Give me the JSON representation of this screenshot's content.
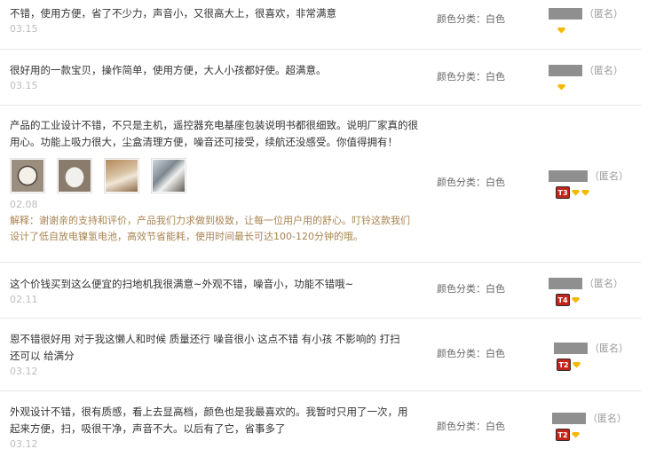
{
  "reviews": [
    {
      "comment": "不错，使用方便，省了不少力，声音小，又很高大上，很喜欢，非常满意",
      "date": "03.15",
      "attr": "颜色分类：白色",
      "anon": "（匿名）",
      "level": "",
      "gems": 1
    },
    {
      "comment": "很好用的一款宝贝，操作简单，使用方便，大人小孩都好使。超满意。",
      "date": "03.15",
      "attr": "颜色分类：白色",
      "anon": "（匿名）",
      "level": "",
      "gems": 1
    },
    {
      "comment": "产品的工业设计不错，不只是主机，遥控器充电基座包装说明书都很细致。说明厂家真的很用心。功能上吸力很大，尘盒清理方便，噪音还可接受，续航还没感受。你值得拥有！",
      "date": "02.08",
      "reply": "解释：谢谢亲的支持和评价，产品我们力求做到极致，让每一位用户用的舒心。叮铃这款我们设计了低自放电镍氢电池，高效节省能耗，使用时间最长可达100-120分钟的哦。",
      "attr": "颜色分类：白色",
      "anon": "（匿名）",
      "level": "T3",
      "gems": 2,
      "photos": [
        "photo-1",
        "photo-2",
        "photo-3",
        "photo-4"
      ]
    },
    {
      "comment": "这个价钱买到这么便宜的扫地机我很满意~外观不错，噪音小，功能不错哦~",
      "date": "02.11",
      "attr": "颜色分类：白色",
      "anon": "（匿名）",
      "level": "T4",
      "gems": 1
    },
    {
      "comment": "恩不错很好用 对于我这懒人和时候 质量还行 噪音很小 这点不错 有小孩 不影响的 打扫还可以 给满分",
      "date": "03.12",
      "attr": "颜色分类：白色",
      "anon": "（匿名）",
      "level": "T2",
      "gems": 1
    },
    {
      "comment": "外观设计不错，很有质感，看上去显高档，颜色也是我最喜欢的。我暂时只用了一次，用起来方便，扫，吸很干净，声音不大。以后有了它，省事多了",
      "date": "03.12",
      "attr": "颜色分类：白色",
      "anon": "（匿名）",
      "level": "T2",
      "gems": 1
    }
  ],
  "colors": {
    "date": "#bcbcbc",
    "reply": "#a88451",
    "level_badge": "#c3251b",
    "gem": "#f5b800",
    "divider": "#e6e6e6"
  }
}
